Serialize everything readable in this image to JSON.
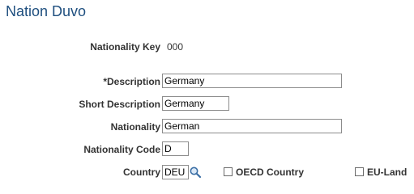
{
  "page": {
    "title": "Nation Duvo"
  },
  "form": {
    "nationality_key": {
      "label": "Nationality Key",
      "value": "000"
    },
    "description": {
      "label": "*Description",
      "value": "Germany"
    },
    "short_description": {
      "label": "Short Description",
      "value": "Germany"
    },
    "nationality": {
      "label": "Nationality",
      "value": "German"
    },
    "nationality_code": {
      "label": "Nationality Code",
      "value": "D"
    },
    "country": {
      "label": "Country",
      "value": "DEU",
      "lookup_icon": "magnifier-icon"
    },
    "oecd_country": {
      "label": "OECD Country",
      "checked": false
    },
    "eu_land": {
      "label": "EU-Land",
      "checked": false
    }
  },
  "colors": {
    "title": "#1f4f7f",
    "label": "#333333",
    "field_border": "#8c8c8c"
  }
}
